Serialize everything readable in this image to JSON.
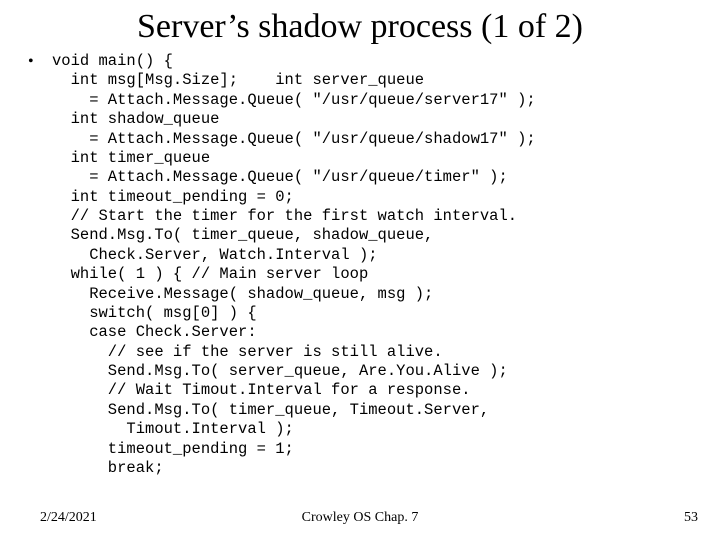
{
  "slide": {
    "title": "Server’s shadow process (1 of 2)",
    "bullet_glyph": "•",
    "code": "void main() {\n  int msg[Msg.Size];    int server_queue\n    = Attach.Message.Queue( \"/usr/queue/server17\" );\n  int shadow_queue\n    = Attach.Message.Queue( \"/usr/queue/shadow17\" );\n  int timer_queue\n    = Attach.Message.Queue( \"/usr/queue/timer\" );\n  int timeout_pending = 0;\n  // Start the timer for the first watch interval.\n  Send.Msg.To( timer_queue, shadow_queue,\n    Check.Server, Watch.Interval );\n  while( 1 ) { // Main server loop\n    Receive.Message( shadow_queue, msg );\n    switch( msg[0] ) {\n    case Check.Server:\n      // see if the server is still alive.\n      Send.Msg.To( server_queue, Are.You.Alive );\n      // Wait Timout.Interval for a response.\n      Send.Msg.To( timer_queue, Timeout.Server,\n        Timout.Interval );\n      timeout_pending = 1;\n      break;"
  },
  "footer": {
    "date": "2/24/2021",
    "center": "Crowley   OS   Chap. 7",
    "pagenum": "53"
  }
}
